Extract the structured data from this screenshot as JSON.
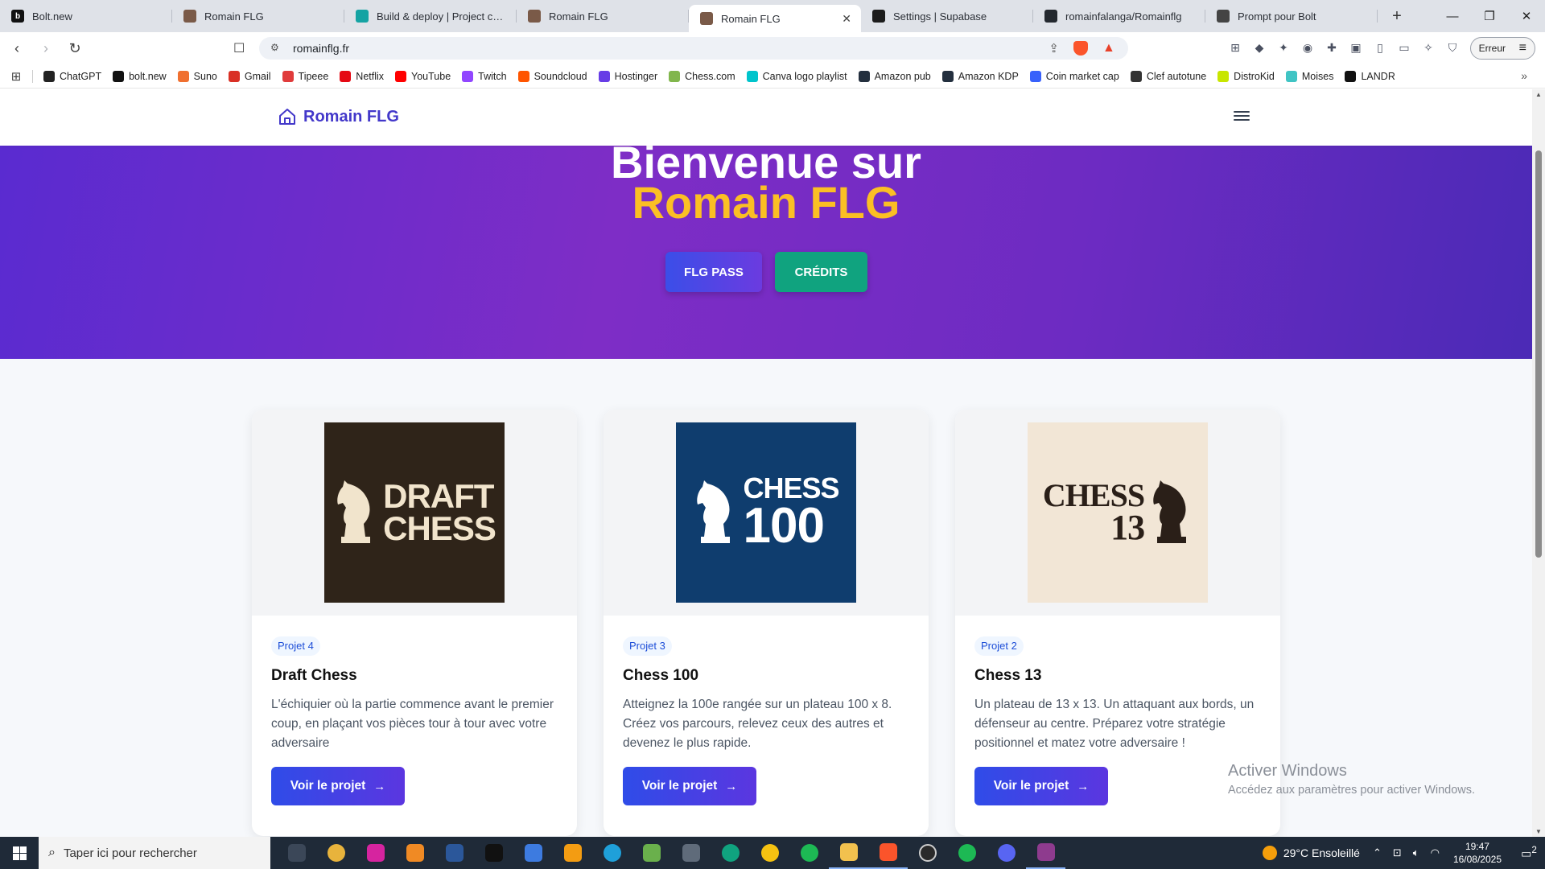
{
  "browser": {
    "tabs": [
      {
        "label": "Bolt.new",
        "favicon_color": "#111111",
        "favicon_text": "b",
        "active": false
      },
      {
        "label": "Romain FLG",
        "favicon_color": "#7a5a48",
        "favicon_text": "",
        "active": false
      },
      {
        "label": "Build & deploy | Project config",
        "favicon_color": "#15a3a3",
        "favicon_text": "",
        "active": false
      },
      {
        "label": "Romain FLG",
        "favicon_color": "#7a5a48",
        "favicon_text": "",
        "active": false
      },
      {
        "label": "Romain FLG",
        "favicon_color": "#7a5a48",
        "favicon_text": "",
        "active": true
      },
      {
        "label": "Settings | Supabase",
        "favicon_color": "#1c1c1c",
        "favicon_text": "",
        "active": false
      },
      {
        "label": "romainfalanga/Romainflg",
        "favicon_color": "#24292f",
        "favicon_text": "",
        "active": false
      },
      {
        "label": "Prompt pour Bolt",
        "favicon_color": "#444444",
        "favicon_text": "",
        "active": false
      }
    ],
    "url": "romainflg.fr",
    "erreur_label": "Erreur",
    "bookmarks": [
      {
        "label": "ChatGPT",
        "color": "#222222"
      },
      {
        "label": "bolt.new",
        "color": "#111111"
      },
      {
        "label": "Suno",
        "color": "#f07030"
      },
      {
        "label": "Gmail",
        "color": "#d93025"
      },
      {
        "label": "Tipeee",
        "color": "#e03b3b"
      },
      {
        "label": "Netflix",
        "color": "#e50914"
      },
      {
        "label": "YouTube",
        "color": "#ff0000"
      },
      {
        "label": "Twitch",
        "color": "#9146ff"
      },
      {
        "label": "Soundcloud",
        "color": "#ff5500"
      },
      {
        "label": "Hostinger",
        "color": "#673de6"
      },
      {
        "label": "Chess.com",
        "color": "#81b64c"
      },
      {
        "label": "Canva logo playlist",
        "color": "#00c4cc"
      },
      {
        "label": "Amazon pub",
        "color": "#232f3e"
      },
      {
        "label": "Amazon KDP",
        "color": "#232f3e"
      },
      {
        "label": "Coin market cap",
        "color": "#3861fb"
      },
      {
        "label": "Clef autotune",
        "color": "#333333"
      },
      {
        "label": "DistroKid",
        "color": "#c8e600"
      },
      {
        "label": "Moises",
        "color": "#40c4c4"
      },
      {
        "label": "LANDR",
        "color": "#111111"
      }
    ]
  },
  "site": {
    "brand": "Romain FLG",
    "hero": {
      "line1": "Bienvenue sur",
      "line2": "Romain FLG",
      "btn_pass": "FLG PASS",
      "btn_credits": "CRÉDITS"
    },
    "cards": [
      {
        "badge": "Projet 4",
        "title": "Draft Chess",
        "desc": "L'échiquier où la partie commence avant le premier coup, en plaçant vos pièces tour à tour avec votre adversaire",
        "cta": "Voir le projet",
        "logo_text_1": "DRAFT",
        "logo_text_2": "CHESS",
        "logo_bg": "#2f2419",
        "logo_fg": "#f1e4cc"
      },
      {
        "badge": "Projet 3",
        "title": "Chess 100",
        "desc": "Atteignez la 100e rangée sur un plateau 100 x 8. Créez vos parcours, relevez ceux des autres et devenez le plus rapide.",
        "cta": "Voir le projet",
        "logo_text_1": "CHESS",
        "logo_text_2": "100",
        "logo_bg": "#0f3d6e",
        "logo_fg": "#ffffff"
      },
      {
        "badge": "Projet 2",
        "title": "Chess 13",
        "desc": "Un plateau de 13 x 13. Un attaquant aux bords, un défenseur au centre. Préparez votre stratégie positionnel et matez votre adversaire !",
        "cta": "Voir le projet",
        "logo_text_1": "CHESS",
        "logo_text_2": "13",
        "logo_bg": "#f2e6d6",
        "logo_fg": "#2a1f18"
      }
    ]
  },
  "windows": {
    "activate_title": "Activer Windows",
    "activate_sub": "Accédez aux paramètres pour activer Windows.",
    "search_placeholder": "Taper ici pour rechercher",
    "weather": "29°C  Ensoleillé",
    "time": "19:47",
    "date": "16/08/2025",
    "notif_count": "2"
  }
}
